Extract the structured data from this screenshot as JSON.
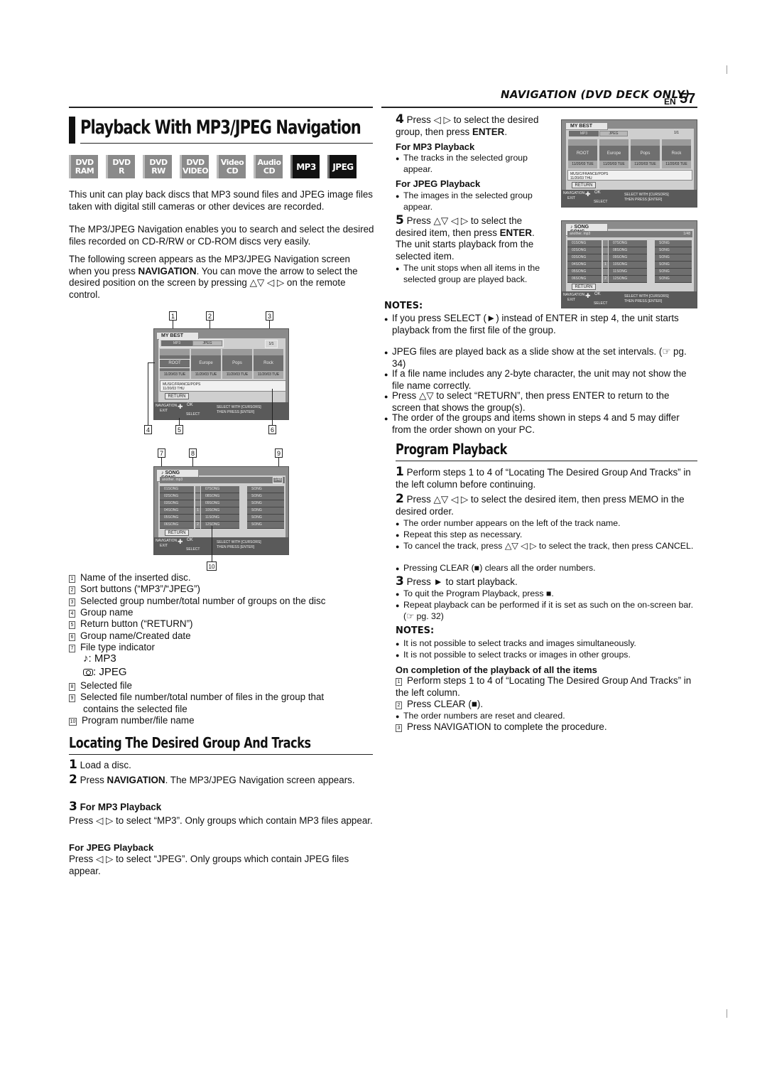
{
  "header": {
    "section": "NAVIGATION (DVD DECK ONLY)",
    "lang": "EN",
    "page_number": "57"
  },
  "title": "Playback With MP3/JPEG Navigation",
  "disc_badges": [
    {
      "line1": "DVD",
      "line2": "RAM",
      "active": false
    },
    {
      "line1": "DVD",
      "line2": "R",
      "active": false
    },
    {
      "line1": "DVD",
      "line2": "RW",
      "active": false
    },
    {
      "line1": "DVD",
      "line2": "VIDEO",
      "active": false
    },
    {
      "line1": "Video",
      "line2": "CD",
      "active": false
    },
    {
      "line1": "Audio",
      "line2": "CD",
      "active": false
    },
    {
      "line1": "MP3",
      "line2": "",
      "active": true
    },
    {
      "line1": "JPEG",
      "line2": "",
      "active": true
    }
  ],
  "intro": {
    "p1": "This unit can play back discs that MP3 sound files and JPEG image files taken with digital still cameras or other devices are recorded.",
    "p2": "The MP3/JPEG Navigation enables you to search and select the desired files recorded on CD-R/RW or CD-ROM discs very easily.",
    "p3_pre": "The following screen appears as the MP3/JPEG Navigation screen when you press ",
    "p3_bold": "NAVIGATION",
    "p3_post": ". You can move the arrow to select the desired position on the screen by pressing △▽ ◁ ▷ on the remote control."
  },
  "group_screen": {
    "disc_name": "MY BEST",
    "sort_mp3": "MP3",
    "sort_jpeg": "JPEG",
    "group_counter": "1/1",
    "groups": [
      {
        "name": "ROOT",
        "date": "11/20/03 TUE"
      },
      {
        "name": "Europe",
        "date": "11/20/03 TUE"
      },
      {
        "name": "Pops",
        "date": "11/20/03 TUE"
      },
      {
        "name": "Rock",
        "date": "11/20/03 TUE"
      }
    ],
    "info_path": "MUSIC/FRANCE/POPS",
    "info_date": "11/20/03 THU",
    "return_label": "RETURN",
    "nav_label": "NAVIGATION",
    "exit_label": "EXIT",
    "ok_label": "OK",
    "select_label": "SELECT",
    "help_line1": "SELECT WITH [CURSORS]",
    "help_line2": "THEN PRESS [ENTER]"
  },
  "track_screen": {
    "file_type_icon": "♪",
    "group_name": "SONG SONG",
    "file_name": "another. mp3",
    "file_counter": "1/48",
    "col1": [
      "01SONG",
      "02SONG",
      "03SONG",
      "04SONG",
      "05SONG",
      "06SONG"
    ],
    "col2": [
      "07SONG",
      "08SONG",
      "09SONG",
      "10SONG",
      "11SONG",
      "12SONG"
    ],
    "col2_program": [
      "",
      "",
      "",
      "1",
      "",
      "2"
    ],
    "col3": [
      "SONG",
      "SONG",
      "SONG",
      "SONG",
      "SONG",
      "SONG"
    ],
    "return_label": "RETURN"
  },
  "callouts": {
    "top": [
      "1",
      "2",
      "3"
    ],
    "bottom": [
      "4",
      "5",
      "6"
    ],
    "top2": [
      "7",
      "8",
      "9"
    ],
    "bottom2": [
      "10"
    ]
  },
  "legend": [
    {
      "num": "1",
      "text": "Name of the inserted disc."
    },
    {
      "num": "2",
      "text": "Sort buttons (“MP3”/“JPEG”)"
    },
    {
      "num": "3",
      "text": "Selected group number/total number of groups on the disc"
    },
    {
      "num": "4",
      "text": "Group name"
    },
    {
      "num": "5",
      "text": "Return button (“RETURN”)"
    },
    {
      "num": "6",
      "text": "Group name/Created date"
    },
    {
      "num": "7",
      "text": "File type indicator"
    },
    {
      "num": "",
      "icon": "♪",
      "text": ":   MP3"
    },
    {
      "num": "",
      "icon": "camera",
      "text": ":  JPEG"
    },
    {
      "num": "8",
      "text": "Selected file"
    },
    {
      "num": "9",
      "text": "Selected file number/total number of files in the group that"
    },
    {
      "num": "",
      "text": "contains the selected file"
    },
    {
      "num": "10",
      "text": "Program number/file name"
    }
  ],
  "locating": {
    "title": "Locating The Desired Group And Tracks",
    "step1": "Load a disc.",
    "step2_pre": "Press ",
    "step2_bold": "NAVIGATION",
    "step2_post": ". The MP3/JPEG Navigation screen appears.",
    "step3_head": "For MP3 Playback",
    "step3_mp3": "Press ◁ ▷ to select “MP3”. Only groups which contain MP3 files appear.",
    "jpeg_head": "For JPEG Playback",
    "jpeg_text": "Press ◁ ▷ to select “JPEG”. Only groups which contain JPEG files appear.",
    "step4_pre": "Press ◁ ▷ to select the desired group, then press ",
    "step4_bold": "ENTER",
    "mp3_head": "For MP3 Playback",
    "mp3_bullet": "The tracks in the selected group appear.",
    "jpeg_head2": "For JPEG Playback",
    "jpeg_bullet": "The images in the selected group appear.",
    "step5_pre": "Press △▽ ◁ ▷ to select the desired item, then press ",
    "step5_bold": "ENTER",
    "step5_post": ". The unit starts playback from the selected item.",
    "step5_bullet": "The unit stops when all items in the selected group are played back."
  },
  "notes1": {
    "heading": "NOTES:",
    "items": [
      "If you press SELECT (►) instead of ENTER in step 4, the unit starts playback from the first file of the group.",
      "JPEG files are played back as a slide show at the set intervals. (☞ pg. 34)",
      "If a file name includes any 2-byte character, the unit may not show the file name correctly.",
      "Press △▽ to select “RETURN”, then press ENTER to return to the screen that shows the group(s).",
      "The order of the groups and items shown in steps 4 and 5 may differ from the order shown on your PC."
    ]
  },
  "program": {
    "title": "Program Playback",
    "step1": "Perform steps 1 to 4 of “Locating The Desired Group And Tracks” in the left column before continuing.",
    "step2": "Press △▽ ◁ ▷ to select the desired item, then press MEMO in the desired order.",
    "step2_bullets": [
      "The order number appears on the left of the track name.",
      "Repeat this step as necessary.",
      "To cancel the track, press △▽ ◁ ▷ to select the track, then press CANCEL.",
      "Pressing CLEAR (■) clears all the order numbers."
    ],
    "step3": "Press ► to start playback.",
    "step3_bullets": [
      "To quit the Program Playback, press ■.",
      "Repeat playback can be performed if it is set as such on the on-screen bar. (☞ pg. 32)"
    ]
  },
  "notes2": {
    "heading": "NOTES:",
    "items": [
      "It is not possible to select tracks and images simultaneously.",
      "It is not possible to select tracks or images in other groups."
    ]
  },
  "completion": {
    "heading": "On completion of the playback of all the items",
    "s1": "Perform steps 1 to 4 of “Locating The Desired Group And Tracks” in the left column.",
    "s2": "Press CLEAR (■).",
    "s2_bullet": "The order numbers are reset and cleared.",
    "s3": "Press NAVIGATION to complete the procedure."
  }
}
